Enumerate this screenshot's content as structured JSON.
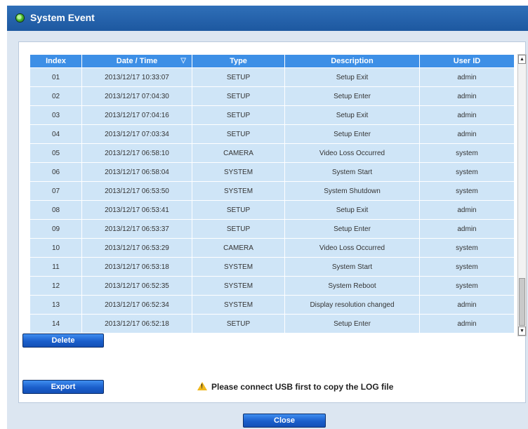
{
  "window": {
    "title": "System Event"
  },
  "table": {
    "columns": [
      "Index",
      "Date / Time",
      "Type",
      "Description",
      "User ID"
    ],
    "rows": [
      [
        "01",
        "2013/12/17 10:33:07",
        "SETUP",
        "Setup Exit",
        "admin"
      ],
      [
        "02",
        "2013/12/17 07:04:30",
        "SETUP",
        "Setup Enter",
        "admin"
      ],
      [
        "03",
        "2013/12/17 07:04:16",
        "SETUP",
        "Setup Exit",
        "admin"
      ],
      [
        "04",
        "2013/12/17 07:03:34",
        "SETUP",
        "Setup Enter",
        "admin"
      ],
      [
        "05",
        "2013/12/17 06:58:10",
        "CAMERA",
        "Video Loss Occurred",
        "system"
      ],
      [
        "06",
        "2013/12/17 06:58:04",
        "SYSTEM",
        "System Start",
        "system"
      ],
      [
        "07",
        "2013/12/17 06:53:50",
        "SYSTEM",
        "System Shutdown",
        "system"
      ],
      [
        "08",
        "2013/12/17 06:53:41",
        "SETUP",
        "Setup Exit",
        "admin"
      ],
      [
        "09",
        "2013/12/17 06:53:37",
        "SETUP",
        "Setup Enter",
        "admin"
      ],
      [
        "10",
        "2013/12/17 06:53:29",
        "CAMERA",
        "Video Loss Occurred",
        "system"
      ],
      [
        "11",
        "2013/12/17 06:53:18",
        "SYSTEM",
        "System Start",
        "system"
      ],
      [
        "12",
        "2013/12/17 06:52:35",
        "SYSTEM",
        "System Reboot",
        "system"
      ],
      [
        "13",
        "2013/12/17 06:52:34",
        "SYSTEM",
        "Display resolution changed",
        "admin"
      ],
      [
        "14",
        "2013/12/17 06:52:18",
        "SETUP",
        "Setup Enter",
        "admin"
      ]
    ],
    "sort_icon": "sort-indicator-icon"
  },
  "buttons": {
    "delete": "Delete",
    "export": "Export",
    "close": "Close"
  },
  "notice": {
    "text": "Please connect USB first to copy the LOG file",
    "icon": "warning-icon"
  },
  "colors": {
    "title_bar": "#2366b0",
    "header": "#3d8fe6",
    "row": "#cfe5f7",
    "dialog_bg": "#dce6f1",
    "button": "#1a5ecb"
  }
}
